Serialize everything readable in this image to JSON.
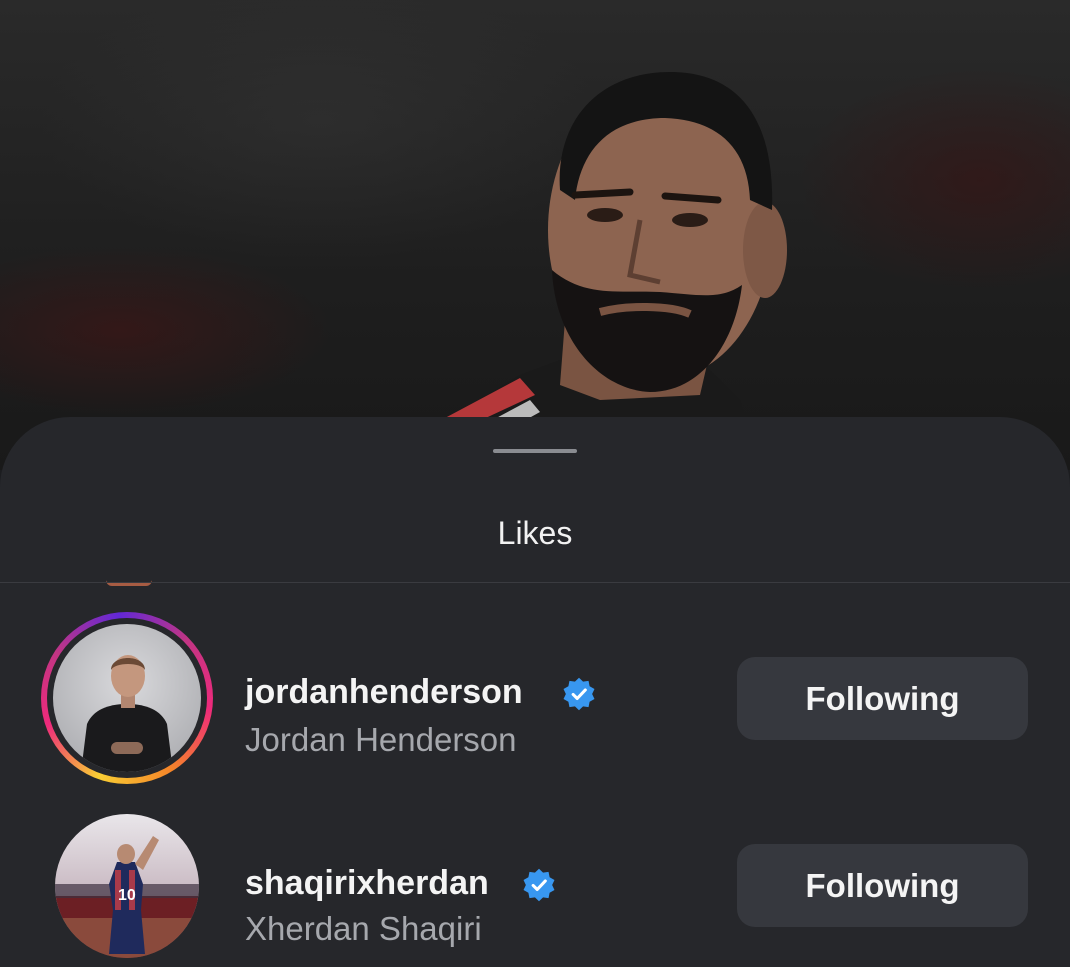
{
  "sheet": {
    "title": "Likes"
  },
  "likes": [
    {
      "username": "jordanhenderson",
      "full_name": "Jordan Henderson",
      "verified": true,
      "has_story": true,
      "button_label": "Following"
    },
    {
      "username": "shaqirixherdan",
      "full_name": "Xherdan Shaqiri",
      "verified": true,
      "has_story": false,
      "button_label": "Following"
    }
  ],
  "icons": {
    "verified": "verified-badge-icon",
    "grabber": "drag-handle-icon"
  },
  "colors": {
    "sheet_background": "#26272b",
    "button_background": "#36383e",
    "verified_blue": "#3897f0",
    "secondary_text": "#a6a8ad"
  }
}
